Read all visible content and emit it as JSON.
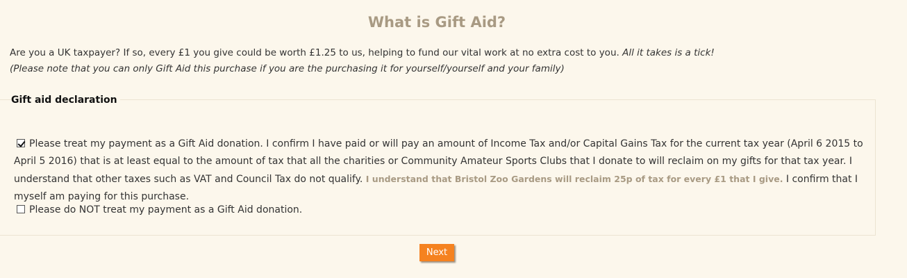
{
  "header": {
    "title": "What is Gift Aid?"
  },
  "intro": {
    "text": "Are you a UK taxpayer? If so, every £1 you give could be worth £1.25 to us, helping to fund our vital work at no extra cost to you.",
    "emphasis": "All it takes is a tick!",
    "note": "(Please note that you can only Gift Aid this purchase if you are the purchasing it for yourself/yourself and your family)"
  },
  "declaration": {
    "legend": "Gift aid declaration",
    "option_yes": {
      "checked": true,
      "text_part1": "Please treat my payment as a Gift Aid donation. I confirm I have paid or will pay an amount of Income Tax and/or Capital Gains Tax for the current tax year (April 6 2015 to April 5 2016) that is at least equal to the amount of tax that all the charities or Community Amateur Sports Clubs that I donate to will reclaim on my gifts for that tax year. I understand that other taxes such as VAT and Council Tax do not qualify.",
      "highlight": "I understand that Bristol Zoo Gardens will reclaim 25p of tax for every £1 that I give.",
      "text_part2": "I confirm that I myself am paying for this purchase."
    },
    "option_no": {
      "checked": false,
      "text": "Please do NOT treat my payment as a Gift Aid donation."
    }
  },
  "actions": {
    "next_label": "Next"
  },
  "colors": {
    "background": "#fcf7ec",
    "title": "#a89a83",
    "accent_button": "#f58220"
  },
  "icons": {
    "checkbox_checked": "checkbox-checked-icon",
    "checkbox_unchecked": "checkbox-unchecked-icon"
  }
}
